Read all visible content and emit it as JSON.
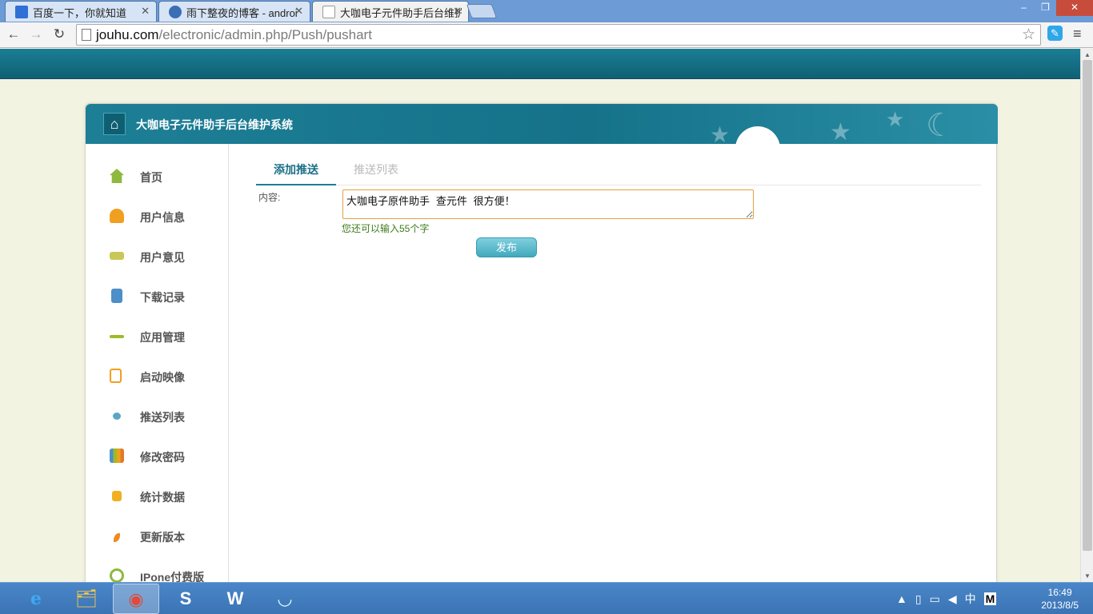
{
  "browser": {
    "tabs": [
      {
        "title": "百度一下，你就知道",
        "icon": "baidu-paw-icon"
      },
      {
        "title": "雨下整夜的博客 - androi",
        "icon": "blog-icon"
      },
      {
        "title": "大咖电子元件助手后台维护",
        "icon": "document-icon"
      }
    ],
    "url_host": "jouhu.com",
    "url_path": "/electronic/admin.php/Push/pushart",
    "window_buttons": {
      "minimize": "–",
      "restore": "❐",
      "close": "✕"
    }
  },
  "page": {
    "panel_title": "大咖电子元件助手后台维护系统",
    "sidebar": {
      "items": [
        {
          "label": "首页",
          "icon": "home-icon",
          "color": "#8fb83f"
        },
        {
          "label": "用户信息",
          "icon": "users-icon",
          "color": "#f0a020"
        },
        {
          "label": "用户意见",
          "icon": "feedback-icon",
          "color": "#c8c858"
        },
        {
          "label": "下载记录",
          "icon": "download-icon",
          "color": "#4d8fc8"
        },
        {
          "label": "应用管理",
          "icon": "app-icon",
          "color": "#9dbb2a"
        },
        {
          "label": "启动映像",
          "icon": "image-icon",
          "color": "#f0a020"
        },
        {
          "label": "推送列表",
          "icon": "chat-bubble-icon",
          "color": "#5aa6c4"
        },
        {
          "label": "修改密码",
          "icon": "books-icon",
          "color": "#e07a2a"
        },
        {
          "label": "统计数据",
          "icon": "lock-icon",
          "color": "#f0b020"
        },
        {
          "label": "更新版本",
          "icon": "leaf-icon",
          "color": "#f08a20"
        },
        {
          "label": "IPone付费版",
          "icon": "refresh-icon",
          "color": "#8fb83f"
        }
      ]
    },
    "tabs": {
      "active": "添加推送",
      "inactive": "推送列表"
    },
    "form": {
      "content_label": "内容:",
      "content_value": "大咖电子原件助手 查元件 很方便！",
      "remaining_hint": "您还可以输入55个字",
      "submit_label": "发布"
    }
  },
  "taskbar": {
    "apps": [
      {
        "name": "internet-explorer-icon",
        "glyph": "e"
      },
      {
        "name": "file-explorer-icon",
        "glyph": "🗂"
      },
      {
        "name": "chrome-icon",
        "glyph": "◉"
      },
      {
        "name": "sogou-icon",
        "glyph": "S"
      },
      {
        "name": "word-icon",
        "glyph": "W"
      },
      {
        "name": "wifi-share-icon",
        "glyph": "◡"
      }
    ],
    "tray": {
      "ime": "中",
      "ime_mode": "M"
    },
    "time": "16:49",
    "date": "2013/8/5"
  },
  "colors": {
    "header_teal": "#1b7e95",
    "accent_orange": "#e2a23f",
    "hint_green": "#3c7b1a"
  }
}
